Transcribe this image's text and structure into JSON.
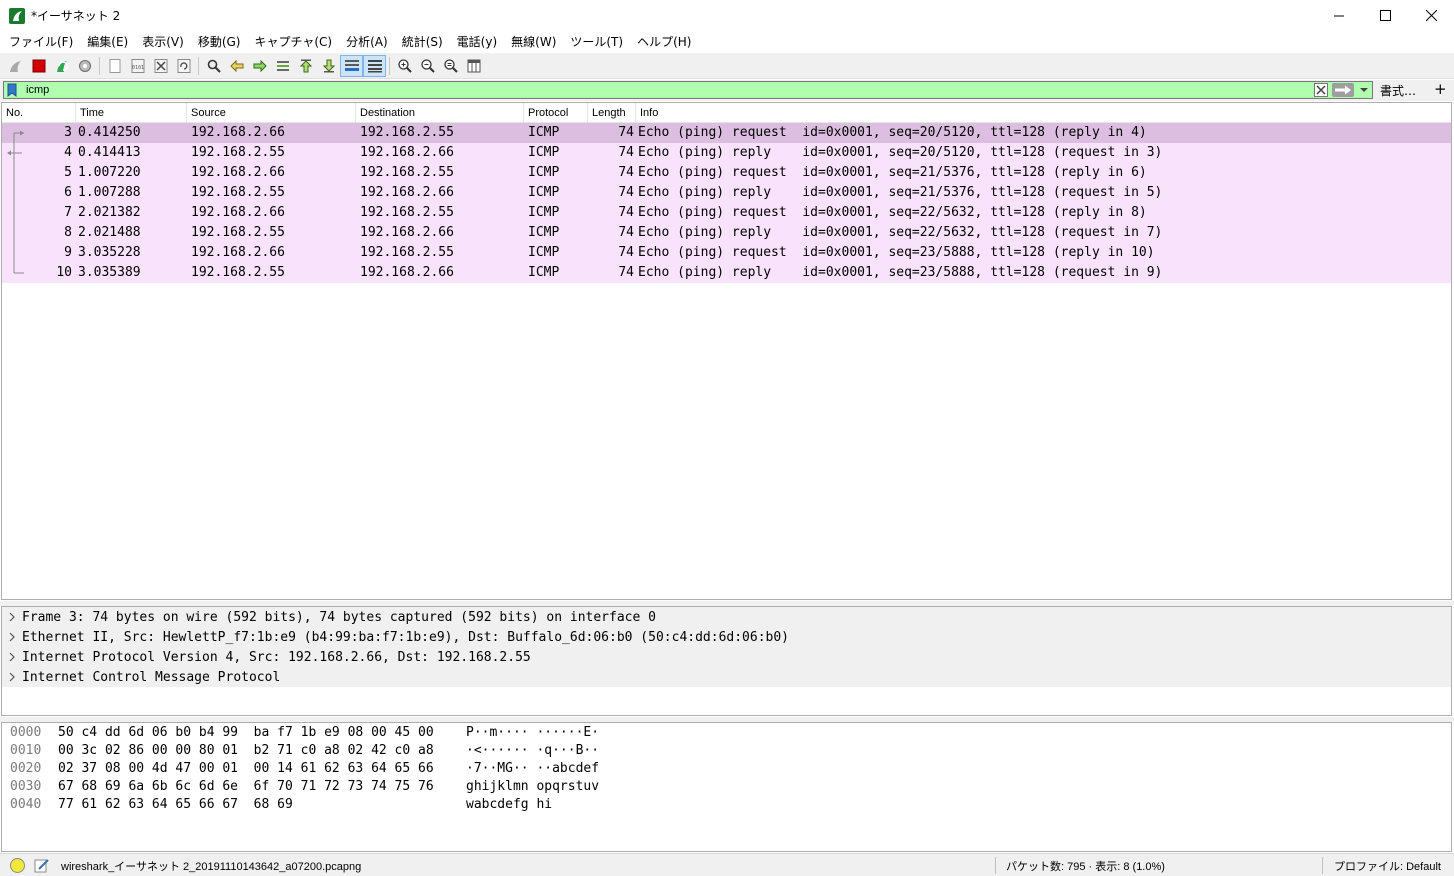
{
  "window": {
    "title": "*イーサネット 2"
  },
  "menu": [
    "ファイル(F)",
    "編集(E)",
    "表示(V)",
    "移動(G)",
    "キャプチャ(C)",
    "分析(A)",
    "統計(S)",
    "電話(y)",
    "無線(W)",
    "ツール(T)",
    "ヘルプ(H)"
  ],
  "filter": {
    "value": "icmp",
    "expressions_label": "書式…",
    "add_label": "+"
  },
  "columns": {
    "no": "No.",
    "time": "Time",
    "source": "Source",
    "destination": "Destination",
    "protocol": "Protocol",
    "length": "Length",
    "info": "Info"
  },
  "packets": [
    {
      "no": "3",
      "time": "0.414250",
      "source": "192.168.2.66",
      "destination": "192.168.2.55",
      "protocol": "ICMP",
      "length": "74",
      "info": "Echo (ping) request  id=0x0001, seq=20/5120, ttl=128 (reply in 4)"
    },
    {
      "no": "4",
      "time": "0.414413",
      "source": "192.168.2.55",
      "destination": "192.168.2.66",
      "protocol": "ICMP",
      "length": "74",
      "info": "Echo (ping) reply    id=0x0001, seq=20/5120, ttl=128 (request in 3)"
    },
    {
      "no": "5",
      "time": "1.007220",
      "source": "192.168.2.66",
      "destination": "192.168.2.55",
      "protocol": "ICMP",
      "length": "74",
      "info": "Echo (ping) request  id=0x0001, seq=21/5376, ttl=128 (reply in 6)"
    },
    {
      "no": "6",
      "time": "1.007288",
      "source": "192.168.2.55",
      "destination": "192.168.2.66",
      "protocol": "ICMP",
      "length": "74",
      "info": "Echo (ping) reply    id=0x0001, seq=21/5376, ttl=128 (request in 5)"
    },
    {
      "no": "7",
      "time": "2.021382",
      "source": "192.168.2.66",
      "destination": "192.168.2.55",
      "protocol": "ICMP",
      "length": "74",
      "info": "Echo (ping) request  id=0x0001, seq=22/5632, ttl=128 (reply in 8)"
    },
    {
      "no": "8",
      "time": "2.021488",
      "source": "192.168.2.55",
      "destination": "192.168.2.66",
      "protocol": "ICMP",
      "length": "74",
      "info": "Echo (ping) reply    id=0x0001, seq=22/5632, ttl=128 (request in 7)"
    },
    {
      "no": "9",
      "time": "3.035228",
      "source": "192.168.2.66",
      "destination": "192.168.2.55",
      "protocol": "ICMP",
      "length": "74",
      "info": "Echo (ping) request  id=0x0001, seq=23/5888, ttl=128 (reply in 10)"
    },
    {
      "no": "10",
      "time": "3.035389",
      "source": "192.168.2.55",
      "destination": "192.168.2.66",
      "protocol": "ICMP",
      "length": "74",
      "info": "Echo (ping) reply    id=0x0001, seq=23/5888, ttl=128 (request in 9)"
    }
  ],
  "details": [
    "Frame 3: 74 bytes on wire (592 bits), 74 bytes captured (592 bits) on interface 0",
    "Ethernet II, Src: HewlettP_f7:1b:e9 (b4:99:ba:f7:1b:e9), Dst: Buffalo_6d:06:b0 (50:c4:dd:6d:06:b0)",
    "Internet Protocol Version 4, Src: 192.168.2.66, Dst: 192.168.2.55",
    "Internet Control Message Protocol"
  ],
  "bytes": [
    {
      "offset": "0000",
      "hex": "50 c4 dd 6d 06 b0 b4 99  ba f7 1b e9 08 00 45 00",
      "ascii": "P··m···· ······E·"
    },
    {
      "offset": "0010",
      "hex": "00 3c 02 86 00 00 80 01  b2 71 c0 a8 02 42 c0 a8",
      "ascii": "·<······ ·q···B··"
    },
    {
      "offset": "0020",
      "hex": "02 37 08 00 4d 47 00 01  00 14 61 62 63 64 65 66",
      "ascii": "·7··MG·· ··abcdef"
    },
    {
      "offset": "0030",
      "hex": "67 68 69 6a 6b 6c 6d 6e  6f 70 71 72 73 74 75 76",
      "ascii": "ghijklmn opqrstuv"
    },
    {
      "offset": "0040",
      "hex": "77 61 62 63 64 65 66 67  68 69",
      "ascii": "wabcdefg hi"
    }
  ],
  "status": {
    "file": "wireshark_イーサネット 2_20191110143642_a07200.pcapng",
    "packets": "パケット数: 795 · 表示: 8 (1.0%)",
    "profile": "プロファイル: Default"
  },
  "colors": {
    "row_bg": "#f9e2fc",
    "row_selected": "#dcbfe0",
    "filter_ok": "#afffaf"
  }
}
